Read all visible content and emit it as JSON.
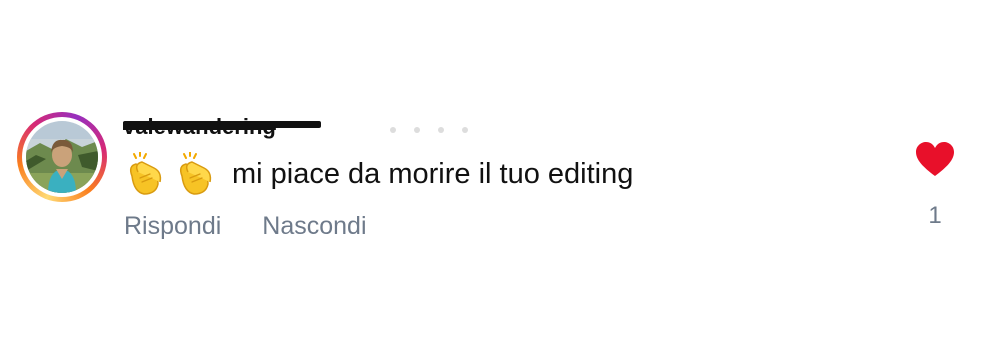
{
  "comment": {
    "username": "valewandering",
    "emojis": [
      "clapping-hands",
      "clapping-hands"
    ],
    "text": "mi piace da morire il tuo editing",
    "actions": {
      "reply_label": "Rispondi",
      "hide_label": "Nascondi"
    },
    "likes": {
      "count": "1",
      "liked": true,
      "icon": "heart-icon",
      "color": "#e8102a"
    }
  },
  "colors": {
    "text": "#111111",
    "secondary": "#6e7a8a",
    "story_ring": [
      "#feda75",
      "#fa7e1e",
      "#d62976",
      "#962fbf"
    ]
  }
}
